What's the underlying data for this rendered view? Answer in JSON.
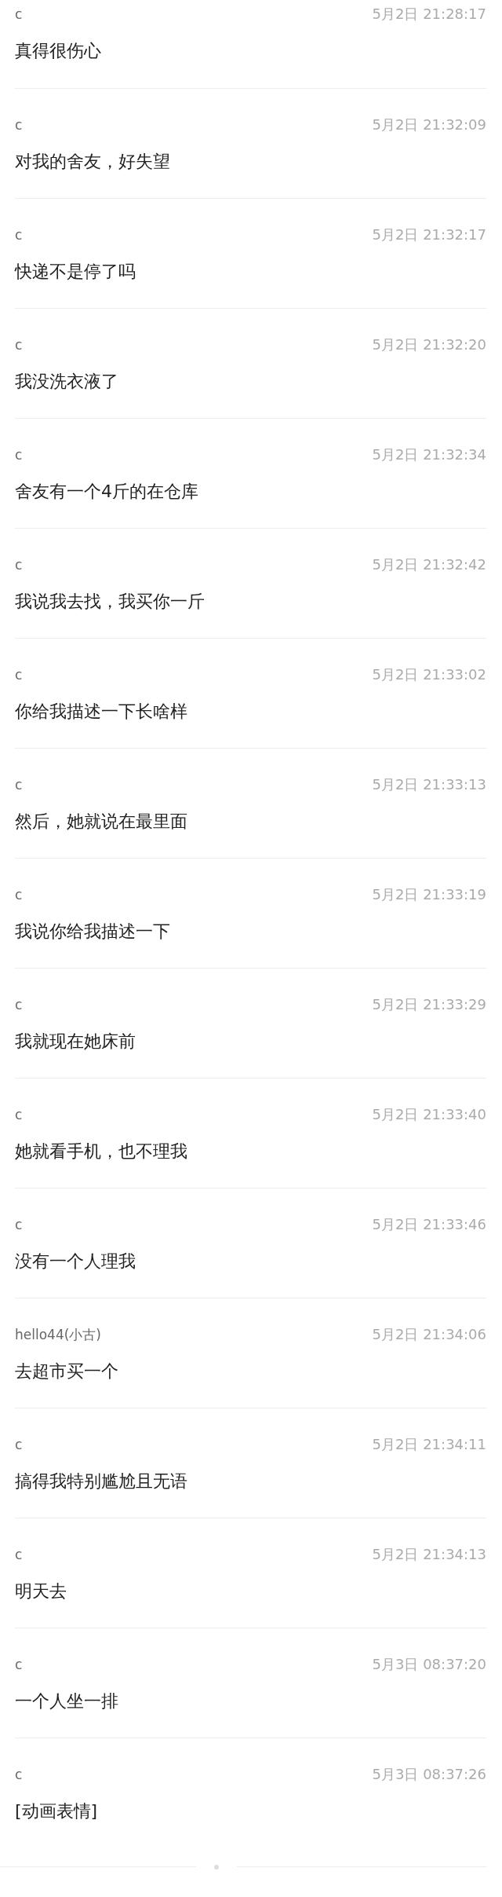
{
  "messages": [
    {
      "sender": "c",
      "time": "5月2日 21:28:17",
      "text": "真得很伤心"
    },
    {
      "sender": "c",
      "time": "5月2日 21:32:09",
      "text": "对我的舍友，好失望"
    },
    {
      "sender": "c",
      "time": "5月2日 21:32:17",
      "text": "快递不是停了吗"
    },
    {
      "sender": "c",
      "time": "5月2日 21:32:20",
      "text": "我没洗衣液了"
    },
    {
      "sender": "c",
      "time": "5月2日 21:32:34",
      "text": "舍友有一个4斤的在仓库"
    },
    {
      "sender": "c",
      "time": "5月2日 21:32:42",
      "text": "我说我去找，我买你一斤"
    },
    {
      "sender": "c",
      "time": "5月2日 21:33:02",
      "text": "你给我描述一下长啥样"
    },
    {
      "sender": "c",
      "time": "5月2日 21:33:13",
      "text": "然后，她就说在最里面"
    },
    {
      "sender": "c",
      "time": "5月2日 21:33:19",
      "text": "我说你给我描述一下"
    },
    {
      "sender": "c",
      "time": "5月2日 21:33:29",
      "text": "我就现在她床前"
    },
    {
      "sender": "c",
      "time": "5月2日 21:33:40",
      "text": "她就看手机，也不理我"
    },
    {
      "sender": "c",
      "time": "5月2日 21:33:46",
      "text": "没有一个人理我"
    },
    {
      "sender": "hello44(小古)",
      "time": "5月2日 21:34:06",
      "text": "去超市买一个"
    },
    {
      "sender": "c",
      "time": "5月2日 21:34:11",
      "text": "搞得我特别尴尬且无语"
    },
    {
      "sender": "c",
      "time": "5月2日 21:34:13",
      "text": "明天去"
    },
    {
      "sender": "c",
      "time": "5月3日 08:37:20",
      "text": "一个人坐一排"
    },
    {
      "sender": "c",
      "time": "5月3日 08:37:26",
      "text": "[动画表情]"
    }
  ]
}
